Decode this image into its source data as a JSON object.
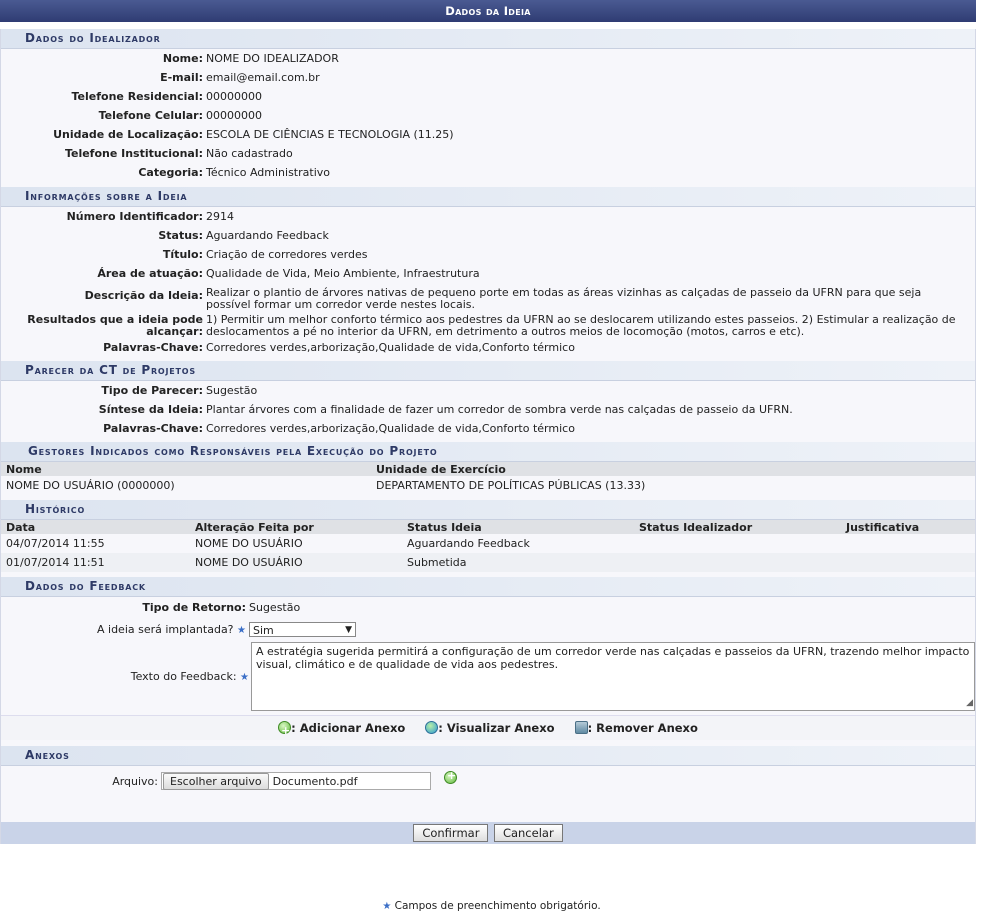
{
  "title": "Dados da Ideia",
  "idealizador": {
    "section_title": "Dados do Idealizador",
    "fields": [
      {
        "label": "Nome:",
        "value": "NOME DO IDEALIZADOR"
      },
      {
        "label": "E-mail:",
        "value": "email@email.com.br"
      },
      {
        "label": "Telefone Residencial:",
        "value": "00000000"
      },
      {
        "label": "Telefone Celular:",
        "value": "00000000"
      },
      {
        "label": "Unidade de Localização:",
        "value": "ESCOLA DE CIÊNCIAS E TECNOLOGIA (11.25)"
      },
      {
        "label": "Telefone Institucional:",
        "value": "Não cadastrado"
      },
      {
        "label": "Categoria:",
        "value": "Técnico Administrativo"
      }
    ]
  },
  "informacoes": {
    "section_title": "Informações sobre a Ideia",
    "fields": [
      {
        "label": "Número Identificador:",
        "value": "2914"
      },
      {
        "label": "Status:",
        "value": "Aguardando Feedback"
      },
      {
        "label": "Título:",
        "value": "Criação de corredores verdes"
      },
      {
        "label": "Área de atuação:",
        "value": "Qualidade de Vida, Meio Ambiente, Infraestrutura"
      },
      {
        "label": "Descrição da Ideia:",
        "value": "Realizar o plantio de árvores nativas de pequeno porte em todas as áreas vizinhas as calçadas de passeio da UFRN para que seja possível formar um corredor verde nestes locais."
      },
      {
        "label": "Resultados que a ideia pode alcançar:",
        "value": "1) Permitir um melhor conforto térmico aos pedestres da UFRN ao se deslocarem utilizando estes passeios. 2) Estimular a realização de deslocamentos a pé no interior da UFRN, em detrimento a outros meios de locomoção (motos, carros e etc)."
      },
      {
        "label": "Palavras-Chave:",
        "value": "Corredores verdes,arborização,Qualidade de vida,Conforto térmico"
      }
    ]
  },
  "parecer": {
    "section_title": "Parecer da CT de Projetos",
    "fields": [
      {
        "label": "Tipo de Parecer:",
        "value": "Sugestão"
      },
      {
        "label": "Síntese da Ideia:",
        "value": "Plantar árvores com a finalidade de fazer um corredor de sombra verde nas calçadas de passeio da UFRN."
      },
      {
        "label": "Palavras-Chave:",
        "value": "Corredores verdes,arborização,Qualidade de vida,Conforto térmico"
      }
    ]
  },
  "gestores": {
    "section_title": "Gestores Indicados como Responsáveis pela Execução do Projeto",
    "headers": [
      "Nome",
      "Unidade de Exercício"
    ],
    "rows": [
      [
        "NOME DO USUÁRIO (0000000)",
        "DEPARTAMENTO DE POLÍTICAS PÚBLICAS (13.33)"
      ]
    ]
  },
  "historico": {
    "section_title": "Histórico",
    "headers": [
      "Data",
      "Alteração Feita por",
      "Status Ideia",
      "Status Idealizador",
      "Justificativa"
    ],
    "rows": [
      [
        "04/07/2014 11:55",
        "NOME DO USUÁRIO",
        "Aguardando Feedback",
        "",
        ""
      ],
      [
        "01/07/2014 11:51",
        "NOME DO USUÁRIO",
        "Submetida",
        "",
        ""
      ]
    ]
  },
  "feedback": {
    "section_title": "Dados do Feedback",
    "tipo_label": "Tipo de Retorno:",
    "tipo_value": "Sugestão",
    "implantada_label": "A ideia será implantada?",
    "implantada_value": "Sim",
    "texto_label": "Texto do Feedback:",
    "texto_value": "A estratégia sugerida permitirá a configuração de um corredor verde nas calçadas e passeios da UFRN, trazendo melhor impacto visual, climático e de qualidade de vida aos pedestres."
  },
  "anexo_actions": {
    "adicionar": ": Adicionar Anexo",
    "visualizar": ": Visualizar Anexo",
    "remover": ": Remover Anexo"
  },
  "anexos": {
    "section_title": "Anexos",
    "arquivo_label": "Arquivo:",
    "choose_button": "Escolher arquivo",
    "file_name": "Documento.pdf"
  },
  "buttons": {
    "confirm": "Confirmar",
    "cancel": "Cancelar"
  },
  "required_note": "Campos de preenchimento obrigatório.",
  "required_star": "★"
}
